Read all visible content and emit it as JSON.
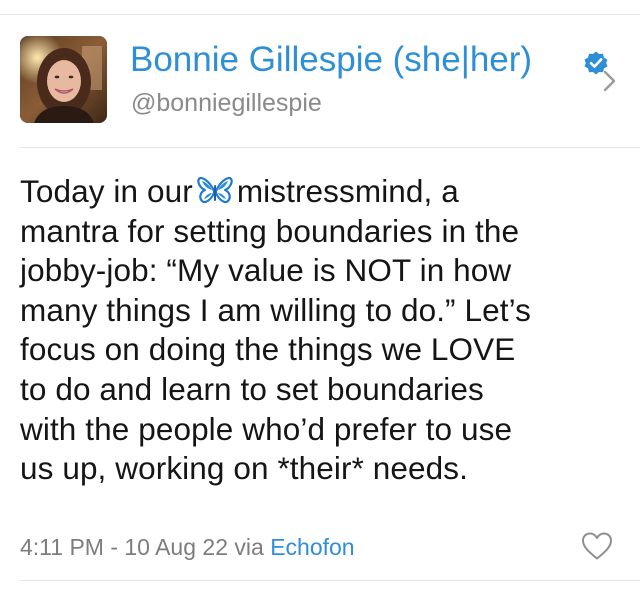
{
  "tweet": {
    "author": {
      "display_name": "Bonnie Gillespie (she|her)",
      "handle": "@bonniegillespie",
      "verified": true,
      "avatar": "profile-photo"
    },
    "body_lines": [
      "Today in our",
      "mistressmind, a",
      "mantra for setting boundaries in the",
      "jobby-job: “My value is NOT in how",
      "many things I am willing to do.” Let’s",
      "focus on doing the things we LOVE",
      "to do and learn to set boundaries",
      "with the people who’d prefer to use",
      "us up, working on *their* needs."
    ],
    "inline_emoji": "butterfly-emoji",
    "meta": {
      "timestamp": "4:11 PM - 10 Aug 22",
      "via": "via",
      "client": "Echofon"
    },
    "icons": {
      "verified": "verified-badge-icon",
      "chevron": "chevron-right-icon",
      "like": "heart-icon"
    },
    "colors": {
      "accent": "#2f8fd6",
      "text": "#151515",
      "muted": "#7d7d7d",
      "divider": "#e6e6e6"
    }
  }
}
